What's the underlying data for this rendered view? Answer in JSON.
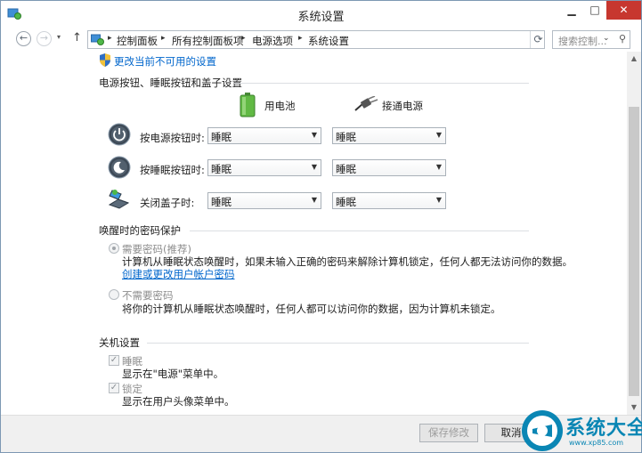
{
  "window": {
    "title": "系统设置",
    "min_glyph": "▁",
    "max_glyph": "□",
    "close_glyph": "✕"
  },
  "navbar": {
    "back_glyph": "←",
    "fwd_glyph": "→",
    "drop_glyph": "▾",
    "up_glyph": "↑",
    "breadcrumbs": [
      "控制面板",
      "所有控制面板项",
      "电源选项",
      "系统设置"
    ],
    "separator": "▸",
    "addr_drop_glyph": "⌄",
    "refresh_glyph": "⟳",
    "search_placeholder": "搜索控制...",
    "search_glyph": "⚲"
  },
  "main": {
    "unavailable_link": "更改当前不可用的设置",
    "power_section_title": "电源按钮、睡眠按钮和盖子设置",
    "col_battery": "用电池",
    "col_plugged": "接通电源",
    "rows": [
      {
        "label": "按电源按钮时:",
        "battery": "睡眠",
        "plugged": "睡眠",
        "icon": "power-button-icon"
      },
      {
        "label": "按睡眠按钮时:",
        "battery": "睡眠",
        "plugged": "睡眠",
        "icon": "sleep-button-icon"
      },
      {
        "label": "关闭盖子时:",
        "battery": "睡眠",
        "plugged": "睡眠",
        "icon": "laptop-lid-icon"
      }
    ],
    "password_section_title": "唤醒时的密码保护",
    "require_password": {
      "label": "需要密码(推荐)",
      "desc": "计算机从睡眠状态唤醒时，如果未输入正确的密码来解除计算机锁定，任何人都无法访问你的数据。",
      "link": "创建或更改用户帐户密码",
      "selected": true
    },
    "no_password": {
      "label": "不需要密码",
      "desc": "将你的计算机从睡眠状态唤醒时，任何人都可以访问你的数据，因为计算机未锁定。",
      "selected": false
    },
    "shutdown_section_title": "关机设置",
    "sleep_option": {
      "label": "睡眠",
      "desc": "显示在\"电源\"菜单中。",
      "checked": true
    },
    "lock_option": {
      "label": "锁定",
      "desc": "显示在用户头像菜单中。",
      "checked": true
    }
  },
  "footer": {
    "save_label": "保存修改",
    "cancel_label": "取消"
  },
  "watermark": {
    "text": "系统大全",
    "url": "www.xp85.com"
  },
  "colors": {
    "accent": "#0066cc",
    "close_button": "#c7372f",
    "watermark": "#0a86b4"
  }
}
